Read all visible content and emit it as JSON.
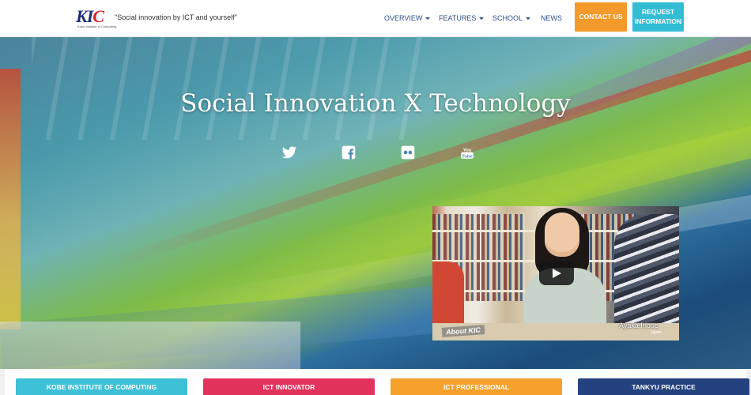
{
  "header": {
    "logo_text_k": "K",
    "logo_text_i": "I",
    "logo_text_c": "C",
    "logo_subtitle": "Kobe Institute of Computing",
    "tagline": "\"Social innovation by ICT and yourself\""
  },
  "nav": {
    "items": [
      {
        "label": "OVERVIEW",
        "has_dropdown": true
      },
      {
        "label": "FEATURES",
        "has_dropdown": true
      },
      {
        "label": "SCHOOL",
        "has_dropdown": true
      },
      {
        "label": "NEWS",
        "has_dropdown": false
      }
    ],
    "contact_label": "CONTACT US",
    "request_label": "REQUEST INFORMATION"
  },
  "hero": {
    "title": "Social Innovation X Technology",
    "social_icons": [
      "twitter-icon",
      "facebook-icon",
      "flickr-icon",
      "youtube-icon"
    ]
  },
  "video": {
    "caption_left": "About KIC",
    "caption_name": "Ayaka Inoue",
    "caption_sub": "Japan"
  },
  "cards": [
    {
      "label": "KOBE INSTITUTE OF COMPUTING",
      "color": "#3ec0d6"
    },
    {
      "label": "ICT INNOVATOR",
      "color": "#e2335c"
    },
    {
      "label": "ICT PROFESSIONAL",
      "color": "#f6a12c"
    },
    {
      "label": "TANKYU PRACTICE",
      "color": "#23427f"
    }
  ],
  "colors": {
    "contact_button": "#f39a2b",
    "request_button": "#33bdd5",
    "nav_text": "#2b4d8c"
  }
}
